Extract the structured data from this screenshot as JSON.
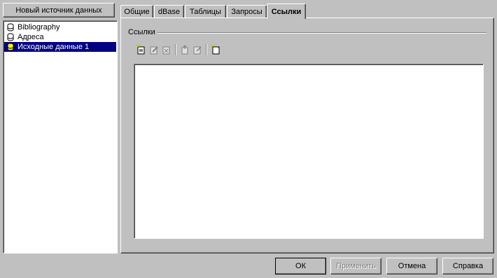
{
  "new_source_button": "Новый источник данных",
  "sources": [
    {
      "label": "Bibliography",
      "icon": "database-icon",
      "selected": false
    },
    {
      "label": "Адреса",
      "icon": "database-icon",
      "selected": false
    },
    {
      "label": "Исходные данные 1",
      "icon": "database-icon",
      "selected": true
    }
  ],
  "tabs": [
    {
      "label": "Общие",
      "active": false
    },
    {
      "label": "dBase",
      "active": false
    },
    {
      "label": "Таблицы",
      "active": false
    },
    {
      "label": "Запросы",
      "active": false
    },
    {
      "label": "Ссылки",
      "active": true
    }
  ],
  "links_section": {
    "title": "Ссылки",
    "toolbar": [
      "new-link-icon",
      "edit-link-icon",
      "delete-link-icon",
      "open-link-icon",
      "rename-link-icon",
      "new-document-icon"
    ]
  },
  "buttons": {
    "ok": "ОК",
    "apply": "Применить",
    "cancel": "Отмена",
    "help": "Справка"
  },
  "colors": {
    "selection": "#000080",
    "face": "#c0c0c0"
  }
}
